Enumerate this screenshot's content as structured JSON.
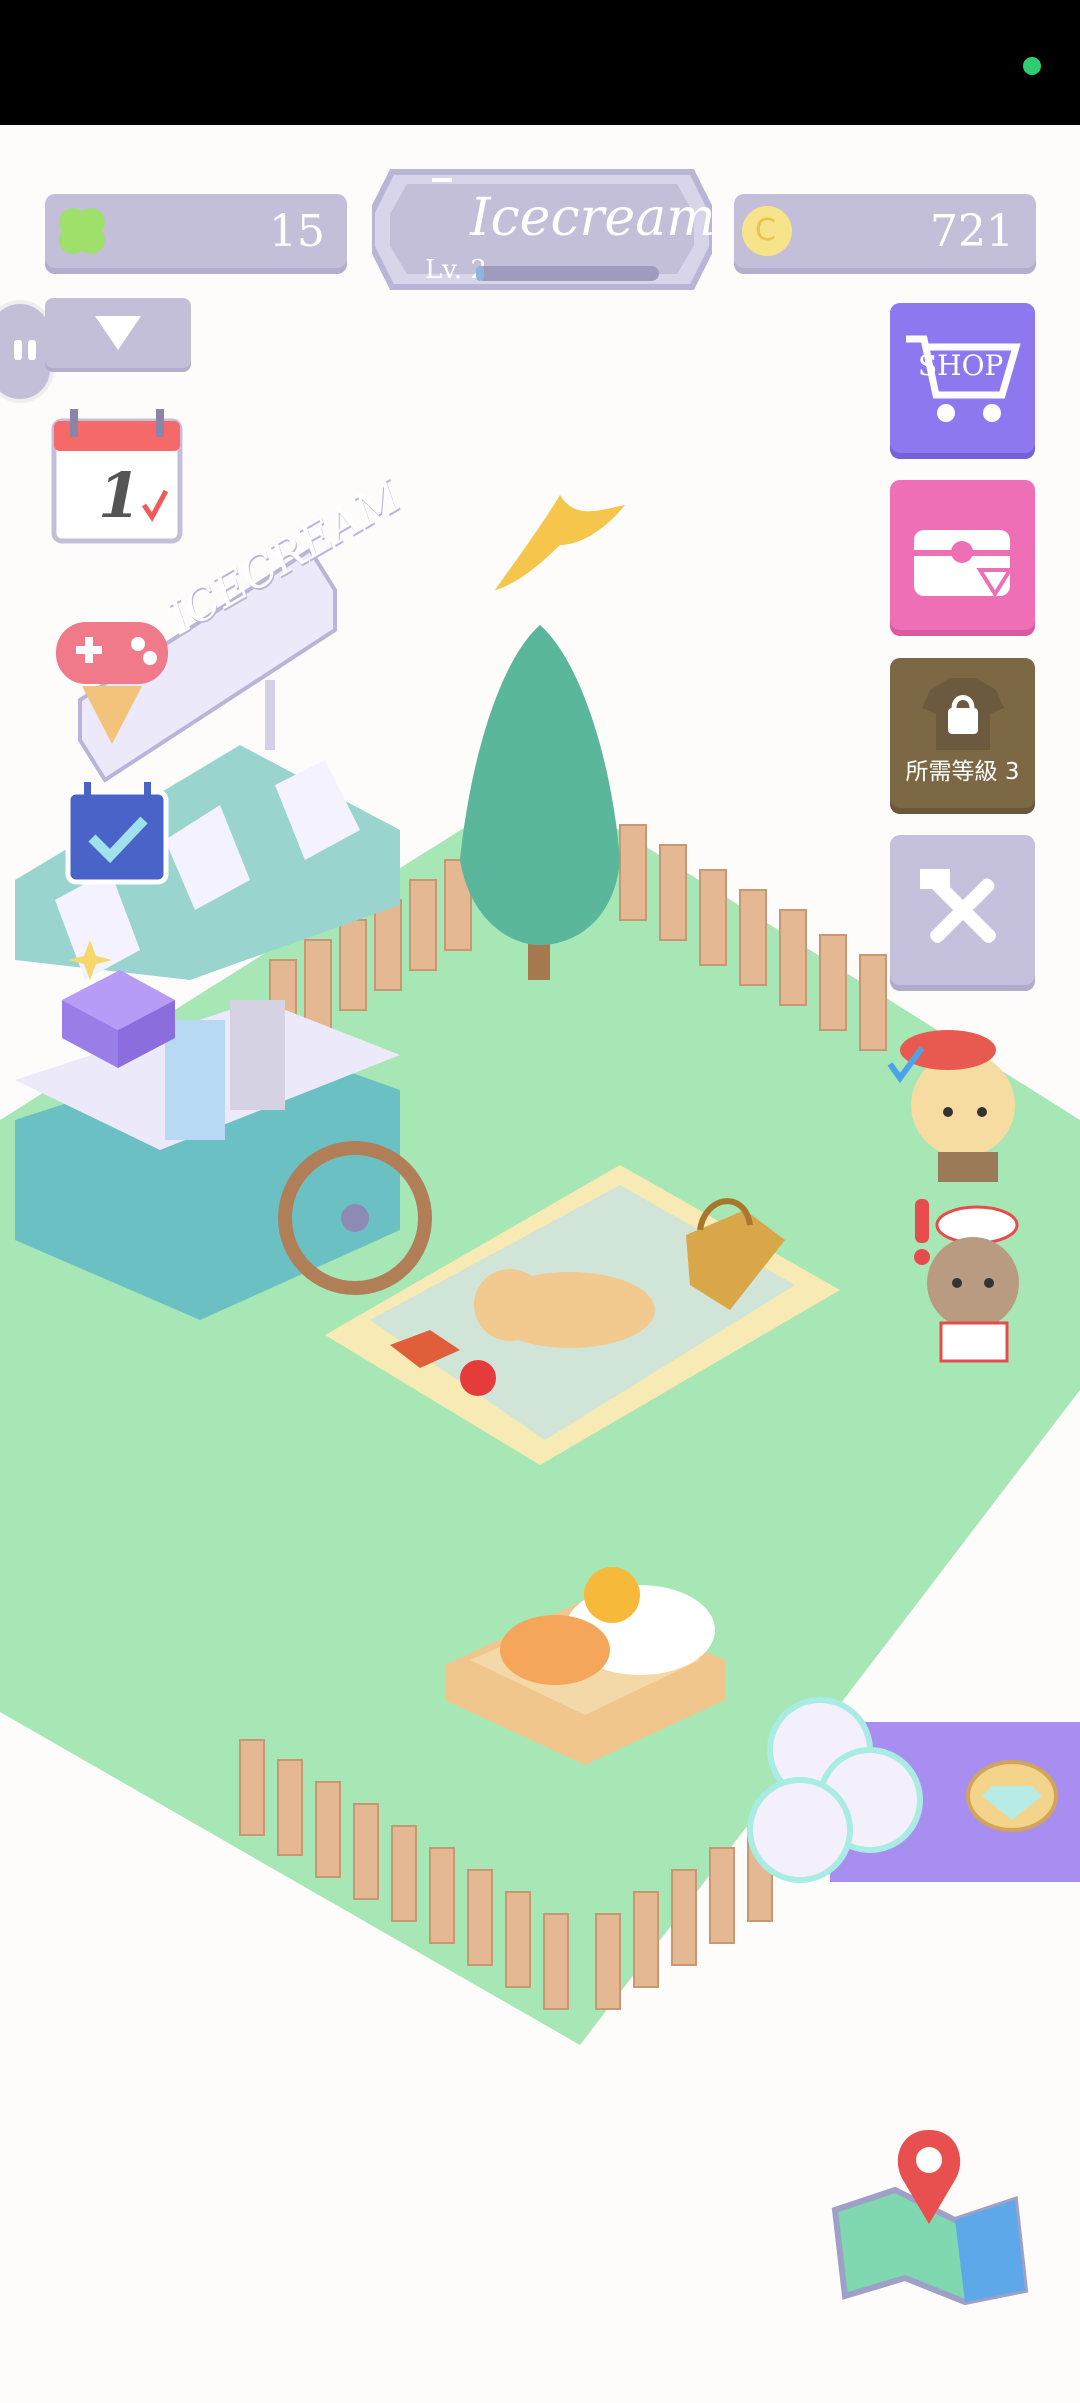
{
  "header": {
    "clover_count": "15",
    "shop_name": "Icecream",
    "level_label": "Lv. 2",
    "level_progress": 0.03,
    "coin_count": "721",
    "coin_symbol": "C"
  },
  "sidebar_left": {
    "calendar_day": "1"
  },
  "sidebar_right": {
    "shop_label": "SHOP",
    "locked_label": "所需等級 3"
  },
  "scene": {
    "cart_sign": "ICECREAM"
  },
  "icons": [
    "clover-icon",
    "coin-icon",
    "dropdown-icon",
    "calendar-icon",
    "gamepad-icon",
    "checklist-icon",
    "gift-box-icon",
    "shop-cart-icon",
    "chest-icon",
    "lock-shirt-icon",
    "tools-icon",
    "map-icon"
  ],
  "colors": {
    "grass": "#a7e6b5",
    "panel": "#c3bfd9",
    "shop": "#8e78f0",
    "chest": "#ee6fb6",
    "locked": "#7d6846"
  }
}
